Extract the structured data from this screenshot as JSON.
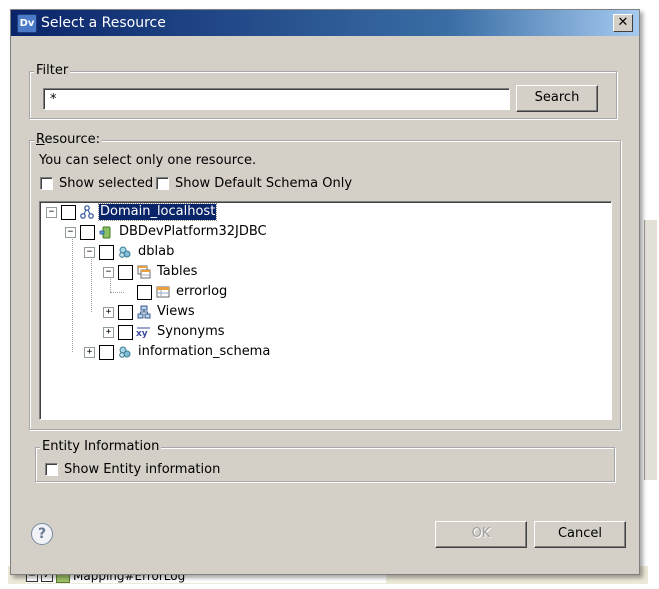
{
  "window": {
    "title": "Select a Resource",
    "app_icon_text": "Dv",
    "close_glyph": "✕"
  },
  "filter": {
    "label": "Filter",
    "value": "*",
    "search_label": "Search"
  },
  "resource": {
    "label": "Resource:",
    "hint": "You can select only one resource.",
    "show_selected_label": "Show selected",
    "show_default_schema_label": "Show Default Schema Only"
  },
  "tree": {
    "nodes": [
      {
        "label": "Domain_localhost",
        "icon": "domain-icon",
        "expander": "−",
        "selected": true
      },
      {
        "label": "DBDevPlatform32JDBC",
        "icon": "datasource-icon",
        "expander": "−"
      },
      {
        "label": "dblab",
        "icon": "schema-icon",
        "expander": "−"
      },
      {
        "label": "Tables",
        "icon": "tables-icon",
        "expander": "−"
      },
      {
        "label": "errorlog",
        "icon": "table-icon",
        "expander": ""
      },
      {
        "label": "Views",
        "icon": "views-icon",
        "expander": "+"
      },
      {
        "label": "Synonyms",
        "icon": "synonyms-icon",
        "expander": "+"
      },
      {
        "label": "information_schema",
        "icon": "schema-icon",
        "expander": "+"
      }
    ]
  },
  "entity": {
    "label": "Entity Information",
    "show_label": "Show Entity information"
  },
  "buttons": {
    "ok_label": "OK",
    "cancel_label": "Cancel",
    "help_glyph": "?"
  },
  "background": {
    "row_label": "Mapping#ErrorLog"
  },
  "colors": {
    "selection": "#0a246a",
    "dialog_bg": "#d4d0c8",
    "titlebar": "#0a246a"
  }
}
